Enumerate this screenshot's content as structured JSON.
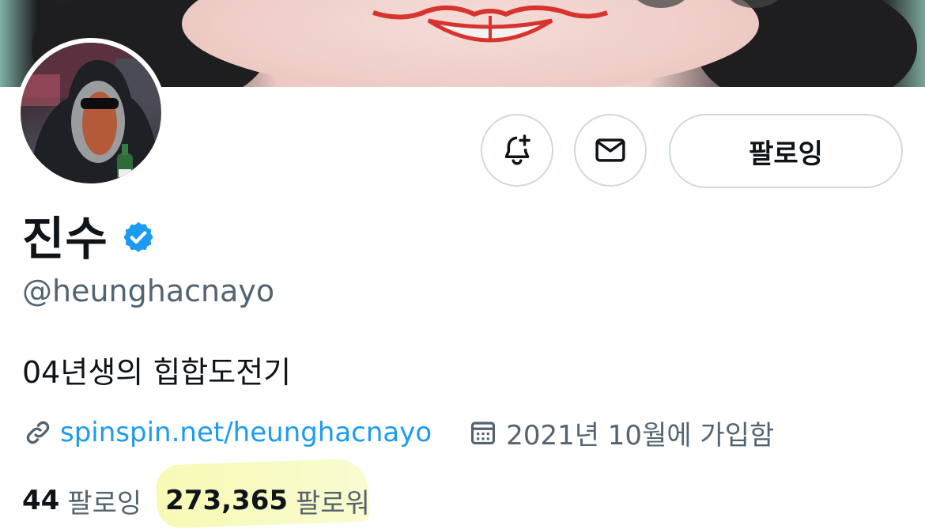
{
  "profile": {
    "display_name": "진수",
    "handle": "@heunghacnayo",
    "bio": "04년생의 힙합도전기",
    "website": "spinspin.net/heunghacnayo",
    "joined": "2021년 10월에 가입함",
    "following_count": "44",
    "following_label": "팔로잉",
    "followers_count": "273,365",
    "followers_label": "팔로워",
    "verified": true
  },
  "actions": {
    "follow_label": "팔로잉",
    "notify_icon": "bell-plus-icon",
    "message_icon": "envelope-icon"
  },
  "colors": {
    "accent": "#1d9bf0",
    "secondary_text": "#536471",
    "highlight": "#f0f578"
  }
}
